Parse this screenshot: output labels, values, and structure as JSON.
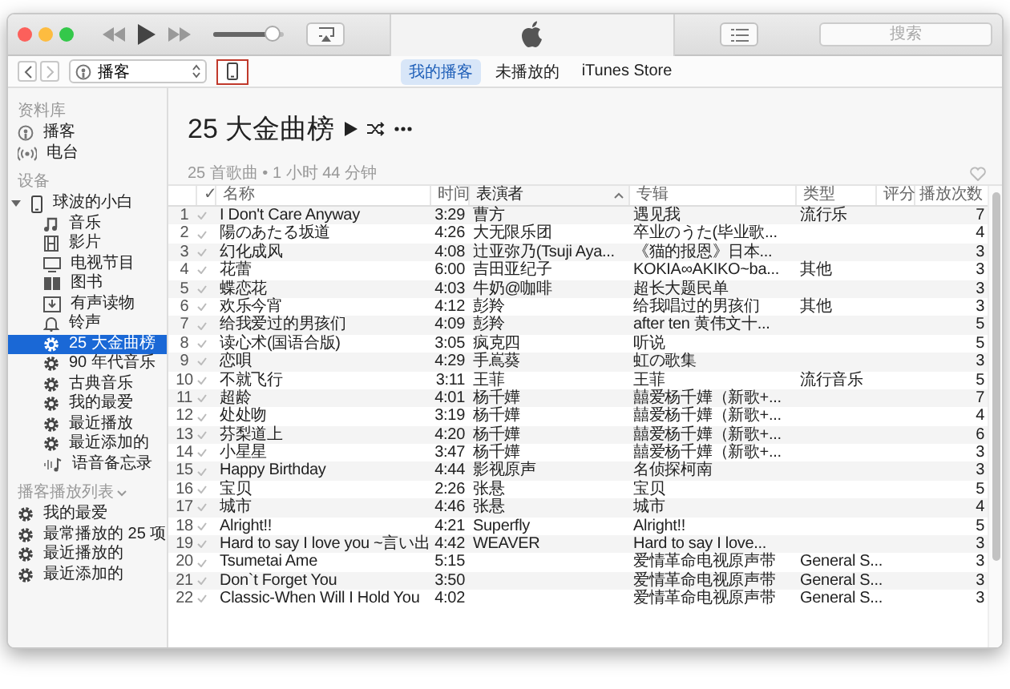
{
  "toolbar": {
    "volume": {
      "level": 0.85
    },
    "search": {
      "placeholder": "搜索"
    }
  },
  "navbar": {
    "source_menu": {
      "value": "播客"
    },
    "tabs": [
      {
        "label": "我的播客",
        "selected": true
      },
      {
        "label": "未播放的",
        "selected": false
      },
      {
        "label": "iTunes Store",
        "selected": false
      }
    ]
  },
  "sidebar": {
    "sections": [
      {
        "title": "资料库",
        "collapsible": false,
        "items": [
          {
            "label": "播客",
            "kind": "podcast",
            "selected": false
          },
          {
            "label": "电台",
            "kind": "radio",
            "selected": false
          }
        ]
      },
      {
        "title": "设备",
        "collapsible": false,
        "items": [
          {
            "label": "球波的小白",
            "kind": "phone",
            "selected": false,
            "expanded": true,
            "children": [
              {
                "label": "音乐",
                "kind": "note",
                "selected": false
              },
              {
                "label": "影片",
                "kind": "film",
                "selected": false
              },
              {
                "label": "电视节目",
                "kind": "tv",
                "selected": false
              },
              {
                "label": "图书",
                "kind": "book",
                "selected": false
              },
              {
                "label": "有声读物",
                "kind": "audiobook",
                "selected": false
              },
              {
                "label": "铃声",
                "kind": "bell",
                "selected": false
              },
              {
                "label": "25 大金曲榜",
                "kind": "gear",
                "selected": true
              },
              {
                "label": "90 年代音乐",
                "kind": "gear",
                "selected": false
              },
              {
                "label": "古典音乐",
                "kind": "gear",
                "selected": false
              },
              {
                "label": "我的最爱",
                "kind": "gear",
                "selected": false
              },
              {
                "label": "最近播放",
                "kind": "gear",
                "selected": false
              },
              {
                "label": "最近添加的",
                "kind": "gear",
                "selected": false
              },
              {
                "label": "语音备忘录",
                "kind": "voice",
                "selected": false
              }
            ]
          }
        ]
      },
      {
        "title": "播客播放列表",
        "collapsible": true,
        "items": [
          {
            "label": "我的最爱",
            "kind": "gear",
            "selected": false
          },
          {
            "label": "最常播放的 25 项",
            "kind": "gear",
            "selected": false
          },
          {
            "label": "最近播放的",
            "kind": "gear",
            "selected": false
          },
          {
            "label": "最近添加的",
            "kind": "gear",
            "selected": false
          }
        ]
      }
    ]
  },
  "playlist": {
    "title": "25 大金曲榜",
    "subtitle": "25 首歌曲 • 1 小时 44 分钟",
    "columns": [
      {
        "label": "✓",
        "sorted": false
      },
      {
        "label": "名称",
        "sorted": false
      },
      {
        "label": "时间",
        "sorted": false
      },
      {
        "label": "表演者",
        "sorted": true
      },
      {
        "label": "专辑",
        "sorted": false
      },
      {
        "label": "类型",
        "sorted": false
      },
      {
        "label": "评分",
        "sorted": false
      },
      {
        "label": "播放次数",
        "sorted": false
      }
    ],
    "rows": [
      {
        "number": "1",
        "checked": true,
        "name": "I Don't Care Anyway",
        "time": "3:29",
        "artist": "曹方",
        "album": "遇见我",
        "genre": "流行乐",
        "plays": "7"
      },
      {
        "number": "2",
        "checked": true,
        "name": "陽のあたる坂道",
        "time": "4:26",
        "artist": "大无限乐团",
        "album": "卒业のうた(毕业歌...",
        "genre": "",
        "plays": "4"
      },
      {
        "number": "3",
        "checked": true,
        "name": "幻化成风",
        "time": "4:08",
        "artist": "辻亚弥乃(Tsuji Aya...",
        "album": "《猫的报恩》日本...",
        "genre": "",
        "plays": "3"
      },
      {
        "number": "4",
        "checked": true,
        "name": "花蕾",
        "time": "6:00",
        "artist": "吉田亚纪子",
        "album": "KOKIA∞AKIKO~ba...",
        "genre": "其他",
        "plays": "3"
      },
      {
        "number": "5",
        "checked": true,
        "name": "蝶恋花",
        "time": "4:03",
        "artist": "牛奶@咖啡",
        "album": "超长大题民单",
        "genre": "",
        "plays": "3"
      },
      {
        "number": "6",
        "checked": true,
        "name": "欢乐今宵",
        "time": "4:12",
        "artist": "彭羚",
        "album": "给我唱过的男孩们",
        "genre": "其他",
        "plays": "3"
      },
      {
        "number": "7",
        "checked": true,
        "name": "给我爱过的男孩们",
        "time": "4:09",
        "artist": "彭羚",
        "album": "after ten 黄伟文十...",
        "genre": "",
        "plays": "5"
      },
      {
        "number": "8",
        "checked": true,
        "name": "读心术(国语合版)",
        "time": "3:05",
        "artist": "疯克四",
        "album": "听说",
        "genre": "",
        "plays": "5"
      },
      {
        "number": "9",
        "checked": true,
        "name": "恋唄",
        "time": "4:29",
        "artist": "手嶌葵",
        "album": "虹の歌集",
        "genre": "",
        "plays": "3"
      },
      {
        "number": "10",
        "checked": true,
        "name": "不就飞行",
        "time": "3:11",
        "artist": "王菲",
        "album": "王菲",
        "genre": "流行音乐",
        "plays": "5"
      },
      {
        "number": "11",
        "checked": true,
        "name": "超龄",
        "time": "4:01",
        "artist": "杨千嬅",
        "album": "囍爱杨千嬅（新歌+...",
        "genre": "",
        "plays": "7"
      },
      {
        "number": "12",
        "checked": true,
        "name": "处处吻",
        "time": "3:19",
        "artist": "杨千嬅",
        "album": "囍爱杨千嬅（新歌+...",
        "genre": "",
        "plays": "4"
      },
      {
        "number": "13",
        "checked": true,
        "name": "芬梨道上",
        "time": "4:20",
        "artist": "杨千嬅",
        "album": "囍爱杨千嬅（新歌+...",
        "genre": "",
        "plays": "6"
      },
      {
        "number": "14",
        "checked": true,
        "name": "小星星",
        "time": "3:47",
        "artist": "杨千嬅",
        "album": "囍爱杨千嬅（新歌+...",
        "genre": "",
        "plays": "3"
      },
      {
        "number": "15",
        "checked": true,
        "name": "Happy Birthday",
        "time": "4:44",
        "artist": "影视原声",
        "album": "名侦探柯南",
        "genre": "",
        "plays": "3"
      },
      {
        "number": "16",
        "checked": true,
        "name": "宝贝",
        "time": "2:26",
        "artist": "张悬",
        "album": "宝贝",
        "genre": "",
        "plays": "5"
      },
      {
        "number": "17",
        "checked": true,
        "name": "城市",
        "time": "4:46",
        "artist": "张悬",
        "album": "城市",
        "genre": "",
        "plays": "4"
      },
      {
        "number": "18",
        "checked": true,
        "name": "Alright!!",
        "time": "4:21",
        "artist": "Superfly",
        "album": "Alright!!",
        "genre": "",
        "plays": "5"
      },
      {
        "number": "19",
        "checked": true,
        "name": "Hard to say I love you ~言い出",
        "time": "4:42",
        "artist": "WEAVER",
        "album": "Hard to say I love...",
        "genre": "",
        "plays": "3"
      },
      {
        "number": "20",
        "checked": true,
        "name": "Tsumetai Ame",
        "time": "5:15",
        "artist": "",
        "album": "爱情革命电视原声带",
        "genre": "General S...",
        "plays": "3"
      },
      {
        "number": "21",
        "checked": true,
        "name": "Don`t Forget You",
        "time": "3:50",
        "artist": "",
        "album": "爱情革命电视原声带",
        "genre": "General S...",
        "plays": "3"
      },
      {
        "number": "22",
        "checked": true,
        "name": "Classic-When Will I Hold You",
        "time": "4:02",
        "artist": "",
        "album": "爱情革命电视原声带",
        "genre": "General S...",
        "plays": "3"
      }
    ]
  }
}
